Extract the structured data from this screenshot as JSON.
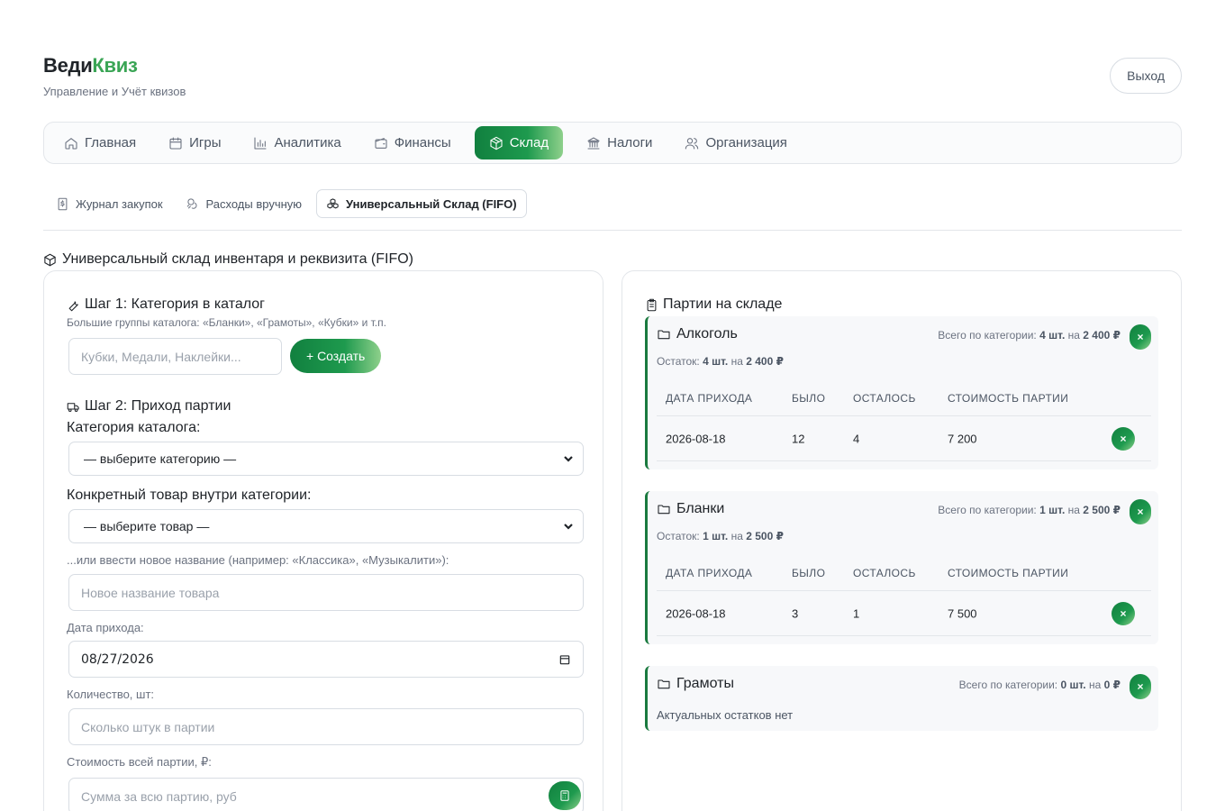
{
  "brand": {
    "title_main": "Веди",
    "title_accent": "Квиз",
    "subtitle": "Управление и Учёт квизов"
  },
  "logout_label": "Выход",
  "nav": [
    {
      "label": "Главная",
      "icon": "home-icon",
      "active": false
    },
    {
      "label": "Игры",
      "icon": "calendar-icon",
      "active": false
    },
    {
      "label": "Аналитика",
      "icon": "bar-chart-icon",
      "active": false
    },
    {
      "label": "Финансы",
      "icon": "wallet-icon",
      "active": false
    },
    {
      "label": "Склад",
      "icon": "box-icon",
      "active": true
    },
    {
      "label": "Налоги",
      "icon": "bank-icon",
      "active": false
    },
    {
      "label": "Организация",
      "icon": "users-icon",
      "active": false
    }
  ],
  "subtabs": [
    {
      "label": "Журнал закупок",
      "icon": "receipt-icon",
      "active": false
    },
    {
      "label": "Расходы вручную",
      "icon": "coins-icon",
      "active": false
    },
    {
      "label": "Универсальный Склад (FIFO)",
      "icon": "boxes-icon",
      "active": true
    }
  ],
  "section_title": "Универсальный склад инвентаря и реквизита (FIFO)",
  "form": {
    "step1_title": "Шаг 1: Категория в каталог",
    "step1_hint": "Большие группы каталога: «Бланки», «Грамоты», «Кубки» и т.п.",
    "category_placeholder": "Кубки, Медали, Наклейки...",
    "create_label": "+ Создать",
    "step2_title": "Шаг 2: Приход партии",
    "catalog_label": "Категория каталога:",
    "catalog_selected": "— выберите категорию —",
    "product_label": "Конкретный товар внутри категории:",
    "product_selected": "— выберите товар —",
    "new_name_hint": "...или ввести новое название (например: «Классика», «Музыкалити»):",
    "new_name_placeholder": "Новое название товара",
    "date_label": "Дата прихода:",
    "date_value": "08/27/2026",
    "qty_label": "Количество, шт:",
    "qty_placeholder": "Сколько штук в партии",
    "cost_label": "Стоимость всей партии, ₽:",
    "cost_placeholder": "Сумма за всю партию, руб"
  },
  "stock": {
    "title": "Партии на складе",
    "total_prefix": "Всего по категории:",
    "rest_prefix": "Остаток:",
    "on": "на",
    "delete_label": "×",
    "columns": [
      "ДАТА ПРИХОДА",
      "БЫЛО",
      "ОСТАЛОСЬ",
      "СТОИМОСТЬ ПАРТИИ"
    ],
    "categories": [
      {
        "name": "Алкоголь",
        "total_qty": "4 шт.",
        "total_sum": "2 400 ₽",
        "rest_qty": "4 шт.",
        "rest_sum": "2 400 ₽",
        "rows": [
          {
            "date": "2026-08-18",
            "was": "12",
            "left": "4",
            "cost": "7 200"
          }
        ]
      },
      {
        "name": "Бланки",
        "total_qty": "1 шт.",
        "total_sum": "2 500 ₽",
        "rest_qty": "1 шт.",
        "rest_sum": "2 500 ₽",
        "rows": [
          {
            "date": "2026-08-18",
            "was": "3",
            "left": "1",
            "cost": "7 500"
          }
        ]
      },
      {
        "name": "Грамоты",
        "total_qty": "0 шт.",
        "total_sum": "0 ₽",
        "empty_note": "Актуальных остатков нет"
      }
    ]
  },
  "colors": {
    "accent": "#1e9a4e",
    "accent_dark": "#11803f",
    "brand_accent": "#3aa555"
  }
}
